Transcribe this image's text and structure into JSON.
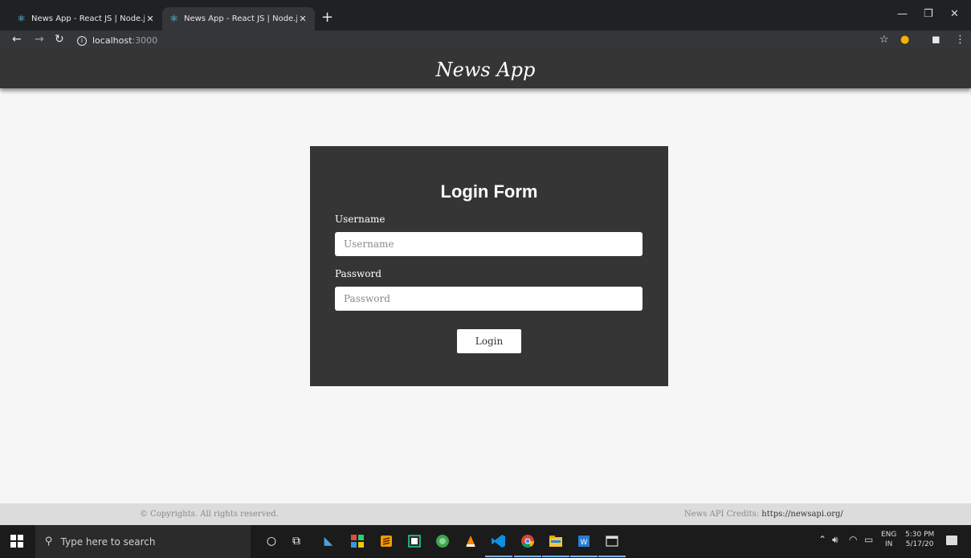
{
  "browser": {
    "tabs": [
      {
        "title": "News App - React JS | Node.js | R",
        "icon": "react-icon"
      },
      {
        "title": "News App - React JS | Node.js | R",
        "icon": "react-icon"
      }
    ],
    "new_tab": "+",
    "url_host": "localhost",
    "url_port": ":3000"
  },
  "app": {
    "brand": "News App"
  },
  "login": {
    "heading": "Login Form",
    "username_label": "Username",
    "username_placeholder": "Username",
    "password_label": "Password",
    "password_placeholder": "Password",
    "button": "Login"
  },
  "footer": {
    "copyright": "© Copyrights. All rights reserved.",
    "credits_prefix": "News API Credits:",
    "credits_link": "https://newsapi.org/"
  },
  "taskbar": {
    "search_placeholder": "Type here to search",
    "lang_top": "ENG",
    "lang_bottom": "IN",
    "time": "5:30 PM",
    "date": "5/17/20"
  },
  "colors": {
    "header_bg": "#353535",
    "form_bg": "#353535",
    "page_bg": "#f6f6f6",
    "footer_bg": "#dcdcdc"
  }
}
